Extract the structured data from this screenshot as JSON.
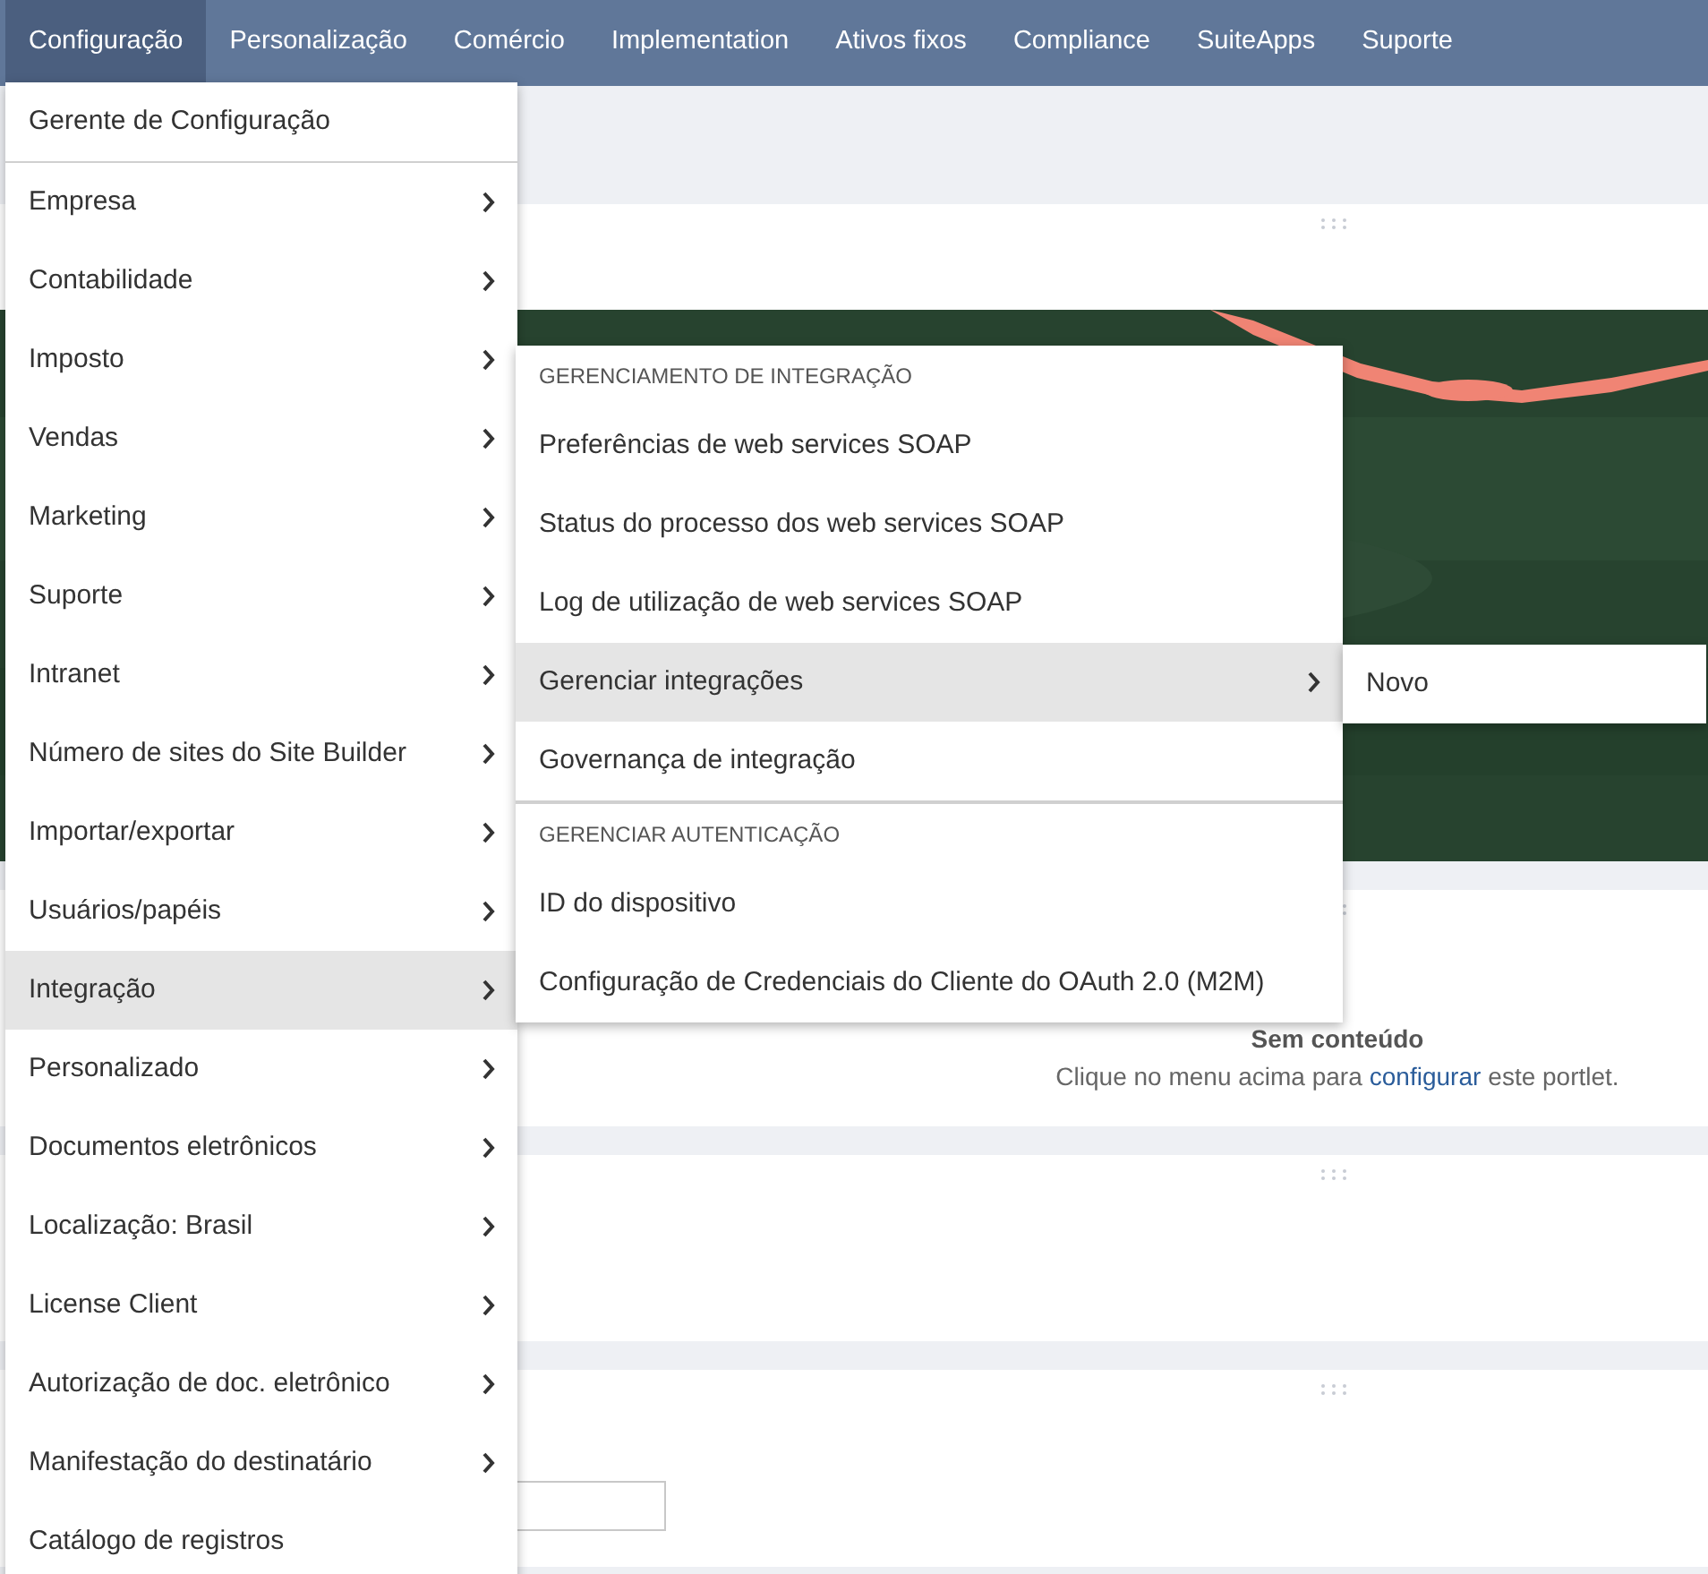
{
  "nav": [
    {
      "label": "Configuração",
      "selected": true
    },
    {
      "label": "Personalização",
      "selected": false
    },
    {
      "label": "Comércio",
      "selected": false
    },
    {
      "label": "Implementation",
      "selected": false
    },
    {
      "label": "Ativos fixos",
      "selected": false
    },
    {
      "label": "Compliance",
      "selected": false
    },
    {
      "label": "SuiteApps",
      "selected": false
    },
    {
      "label": "Suporte",
      "selected": false
    }
  ],
  "portlet_empty": {
    "title": "Sem conteúdo",
    "message_before": "Clique no menu acima para",
    "link": "configurar",
    "message_after": "este portlet."
  },
  "menu": [
    {
      "label": "Gerente de Configuração",
      "has_submenu": false,
      "selected": false
    },
    {
      "label": "Empresa",
      "has_submenu": true,
      "selected": false
    },
    {
      "label": "Contabilidade",
      "has_submenu": true,
      "selected": false
    },
    {
      "label": "Imposto",
      "has_submenu": true,
      "selected": false
    },
    {
      "label": "Vendas",
      "has_submenu": true,
      "selected": false
    },
    {
      "label": "Marketing",
      "has_submenu": true,
      "selected": false
    },
    {
      "label": "Suporte",
      "has_submenu": true,
      "selected": false
    },
    {
      "label": "Intranet",
      "has_submenu": true,
      "selected": false
    },
    {
      "label": "Número de sites do Site Builder",
      "has_submenu": true,
      "selected": false
    },
    {
      "label": "Importar/exportar",
      "has_submenu": true,
      "selected": false
    },
    {
      "label": "Usuários/papéis",
      "has_submenu": true,
      "selected": false
    },
    {
      "label": "Integração",
      "has_submenu": true,
      "selected": true
    },
    {
      "label": "Personalizado",
      "has_submenu": true,
      "selected": false
    },
    {
      "label": "Documentos eletrônicos",
      "has_submenu": true,
      "selected": false
    },
    {
      "label": "Localização: Brasil",
      "has_submenu": true,
      "selected": false
    },
    {
      "label": "License Client",
      "has_submenu": true,
      "selected": false
    },
    {
      "label": "Autorização de doc. eletrônico",
      "has_submenu": true,
      "selected": false
    },
    {
      "label": "Manifestação do destinatário",
      "has_submenu": true,
      "selected": false
    },
    {
      "label": "Catálogo de registros",
      "has_submenu": false,
      "selected": false
    }
  ],
  "submenu": [
    {
      "kind": "header",
      "label": "GERENCIAMENTO DE INTEGRAÇÃO"
    },
    {
      "kind": "item",
      "label": "Preferências de web services SOAP",
      "has_submenu": false,
      "selected": false
    },
    {
      "kind": "item",
      "label": "Status do processo dos web services SOAP",
      "has_submenu": false,
      "selected": false
    },
    {
      "kind": "item",
      "label": "Log de utilização de web services SOAP",
      "has_submenu": false,
      "selected": false
    },
    {
      "kind": "item",
      "label": "Gerenciar integrações",
      "has_submenu": true,
      "selected": true
    },
    {
      "kind": "item",
      "label": "Governança de integração",
      "has_submenu": false,
      "selected": false
    },
    {
      "kind": "header",
      "label": "GERENCIAR AUTENTICAÇÃO"
    },
    {
      "kind": "item",
      "label": "ID do dispositivo",
      "has_submenu": false,
      "selected": false
    },
    {
      "kind": "item",
      "label": "Configuração de Credenciais do Cliente do OAuth 2.0 (M2M)",
      "has_submenu": false,
      "selected": false
    }
  ],
  "submenu_2": [
    {
      "label": "Novo",
      "has_submenu": false,
      "selected": false
    }
  ]
}
